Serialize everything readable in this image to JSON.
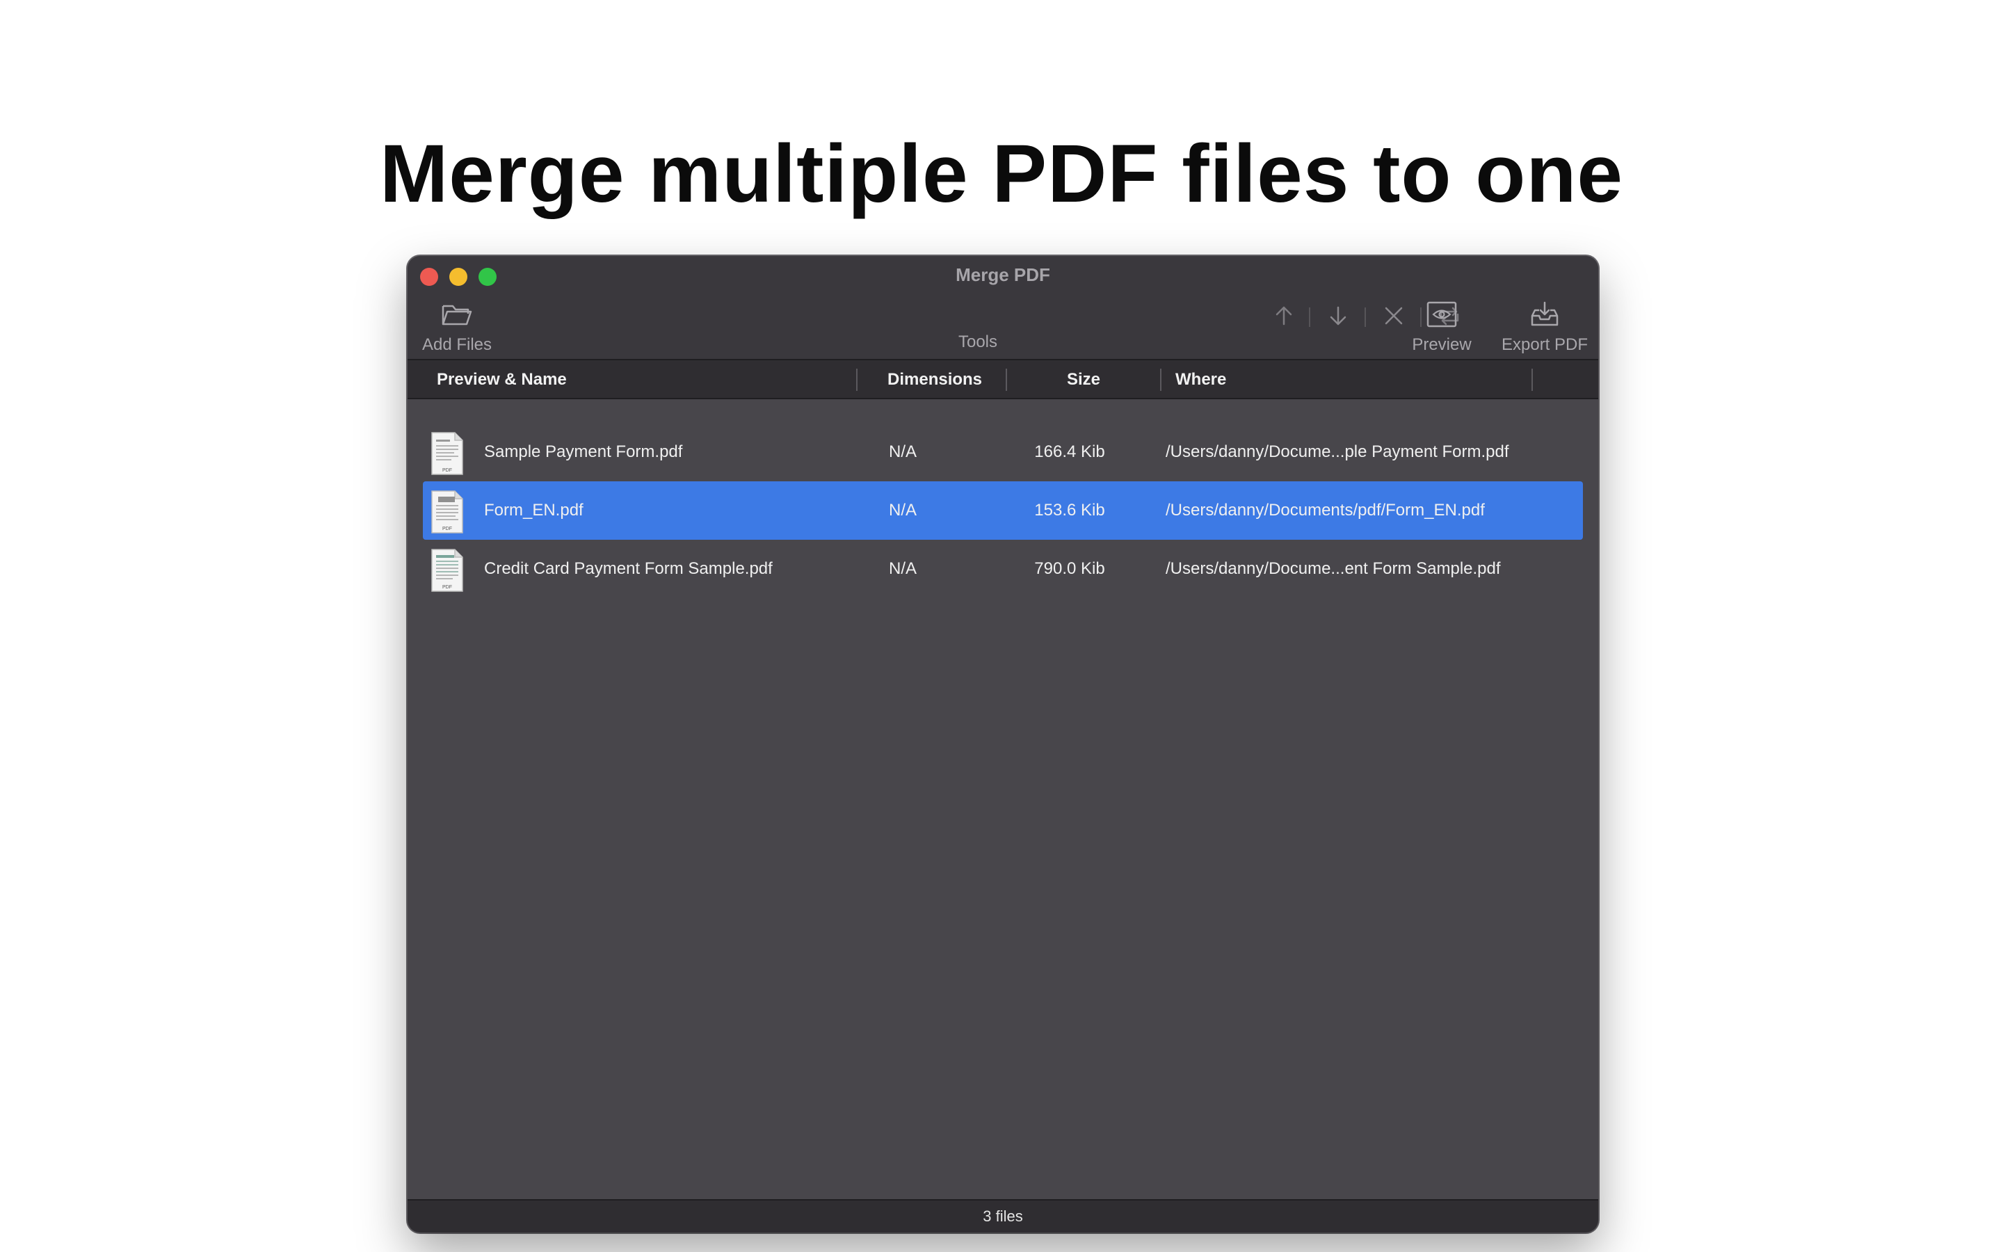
{
  "headline": "Merge multiple PDF files to one",
  "window": {
    "title": "Merge PDF",
    "traffic_lights": {
      "close": "#ee5a52",
      "minimize": "#f5bd2e",
      "maximize": "#31c548"
    }
  },
  "toolbar": {
    "add_files": {
      "label": "Add Files",
      "icon": "folder-icon"
    },
    "tools": {
      "label": "Tools",
      "icons": [
        "arrow-up-icon",
        "arrow-down-icon",
        "close-x-icon",
        "repeat-icon"
      ]
    },
    "preview": {
      "label": "Preview",
      "icon": "eye-icon"
    },
    "export": {
      "label": "Export PDF",
      "icon": "tray-download-icon"
    }
  },
  "table": {
    "columns": [
      "Preview & Name",
      "Dimensions",
      "Size",
      "Where"
    ],
    "rows": [
      {
        "name": "Sample Payment Form.pdf",
        "dimensions": "N/A",
        "size": "166.4 Kib",
        "where": "/Users/danny/Docume...ple Payment Form.pdf",
        "selected": false
      },
      {
        "name": "Form_EN.pdf",
        "dimensions": "N/A",
        "size": "153.6 Kib",
        "where": "/Users/danny/Documents/pdf/Form_EN.pdf",
        "selected": true
      },
      {
        "name": "Credit Card Payment Form Sample.pdf",
        "dimensions": "N/A",
        "size": "790.0 Kib",
        "where": "/Users/danny/Docume...ent Form Sample.pdf",
        "selected": false
      }
    ]
  },
  "status": "3 files",
  "colors": {
    "selection": "#3d7ae5",
    "window_bg": "#48464b",
    "toolbar_bg": "#3a383d"
  }
}
